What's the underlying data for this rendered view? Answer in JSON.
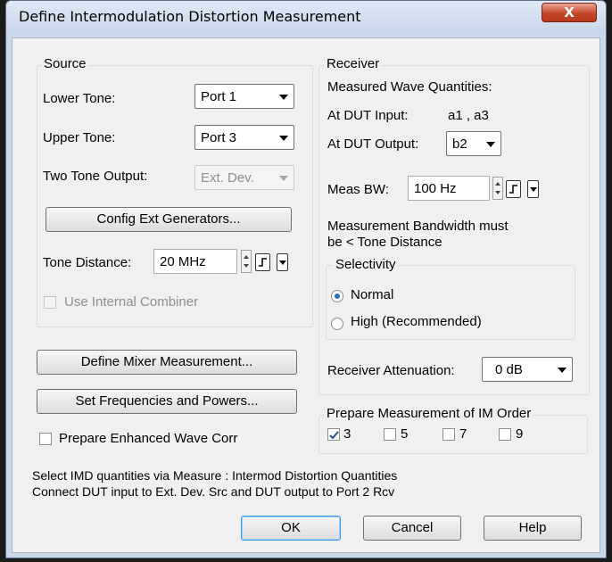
{
  "window": {
    "title": "Define Intermodulation Distortion Measurement",
    "close_label": "X"
  },
  "source": {
    "legend": "Source",
    "lower_tone_label": "Lower Tone:",
    "lower_tone_value": "Port 1",
    "upper_tone_label": "Upper Tone:",
    "upper_tone_value": "Port 3",
    "two_tone_output_label": "Two Tone Output:",
    "two_tone_output_value": "Ext. Dev.",
    "config_ext_generators": "Config Ext Generators...",
    "tone_distance_label": "Tone Distance:",
    "tone_distance_value": "20 MHz",
    "use_internal_combiner": "Use Internal Combiner"
  },
  "receiver": {
    "legend": "Receiver",
    "measured_wave_quantities": "Measured Wave Quantities:",
    "at_dut_input_label": "At DUT Input:",
    "at_dut_input_value": "a1 , a3",
    "at_dut_output_label": "At DUT Output:",
    "at_dut_output_value": "b2",
    "meas_bw_label": "Meas BW:",
    "meas_bw_value": "100 Hz",
    "bandwidth_note_1": "Measurement Bandwidth must",
    "bandwidth_note_2": "be < Tone Distance",
    "selectivity": {
      "legend": "Selectivity",
      "normal": "Normal",
      "high": "High (Recommended)",
      "selected": "Normal"
    },
    "attenuation_label": "Receiver Attenuation:",
    "attenuation_value": "0 dB"
  },
  "buttons": {
    "define_mixer": "Define Mixer Measurement...",
    "set_freq_powers": "Set Frequencies and Powers...",
    "ok": "OK",
    "cancel": "Cancel",
    "help": "Help"
  },
  "enhanced_wave_corr": "Prepare Enhanced Wave Corr",
  "im_order": {
    "legend": "Prepare Measurement of IM Order",
    "options": [
      {
        "label": "3",
        "checked": true
      },
      {
        "label": "5",
        "checked": false
      },
      {
        "label": "7",
        "checked": false
      },
      {
        "label": "9",
        "checked": false
      }
    ]
  },
  "footer": {
    "line1": "Select IMD quantities via Measure : Intermod Distortion Quantities",
    "line2": "Connect DUT input to Ext. Dev. Src and DUT output to Port 2 Rcv"
  },
  "icons": [
    "close-icon",
    "chevron-down-icon",
    "spin-up-icon",
    "spin-down-icon",
    "step-size-icon",
    "checkmark-icon"
  ],
  "colors": {
    "titlebar": "#c9d8ea",
    "close_button": "#c5472b",
    "dialog_bg": "#f0f0f0",
    "radio_dot": "#2a73c8",
    "default_button_border": "#3399ff"
  }
}
